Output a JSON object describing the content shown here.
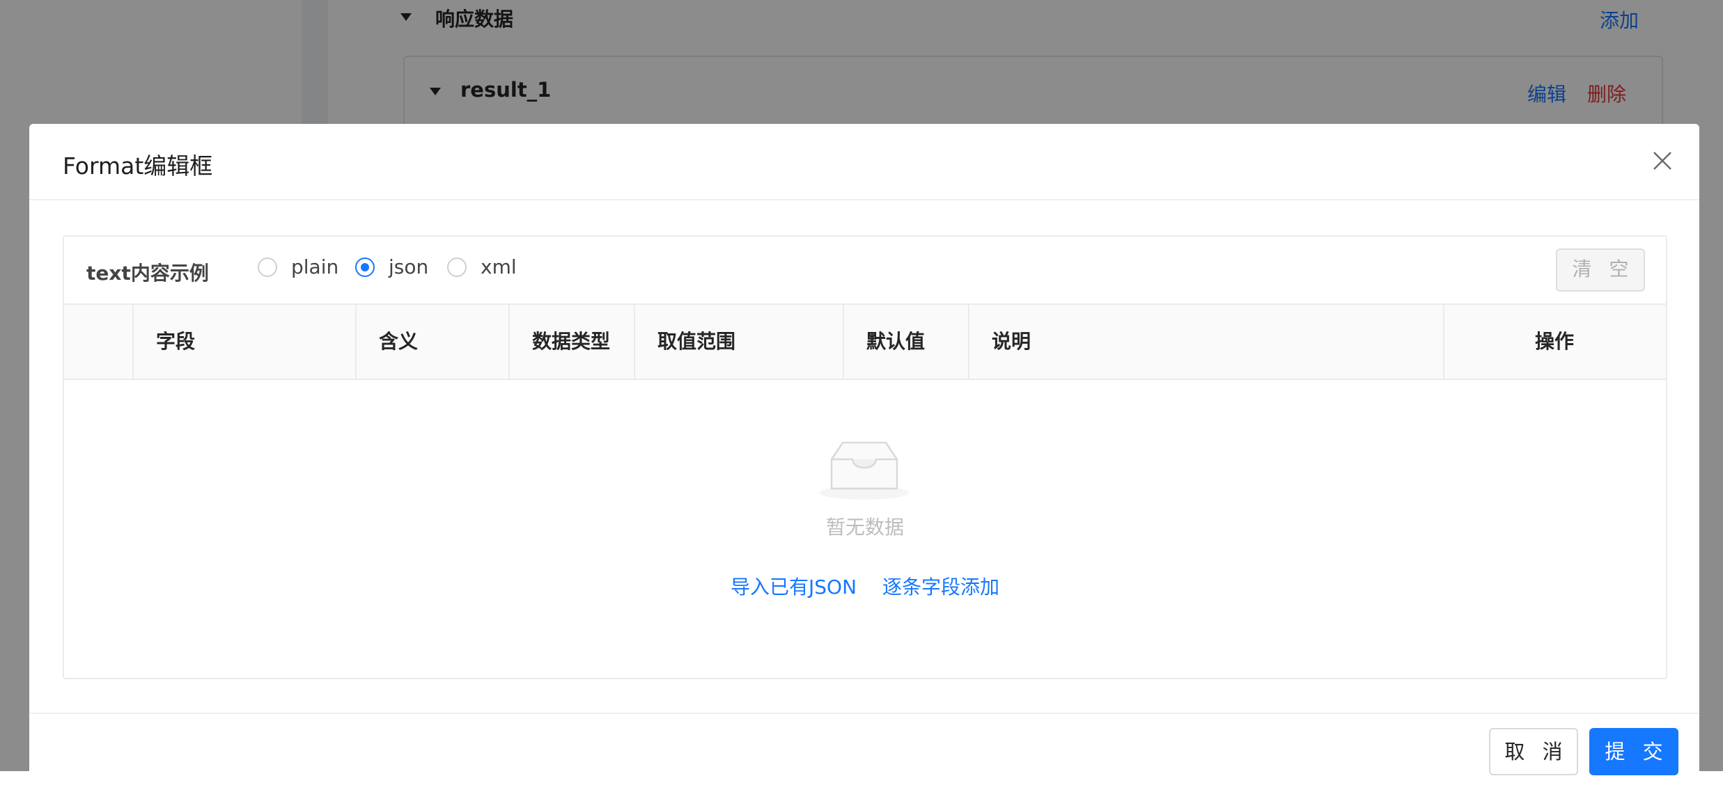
{
  "background": {
    "response_section": {
      "title": "响应数据",
      "add_label": "添加"
    },
    "result_card": {
      "title": "result_1",
      "edit_label": "编辑",
      "delete_label": "删除"
    }
  },
  "modal": {
    "title": "Format编辑框",
    "close_icon": "close-icon",
    "toolbar": {
      "label": "text内容示例",
      "format_options": [
        "plain",
        "json",
        "xml"
      ],
      "selected_format": "json",
      "clear_label": "清 空"
    },
    "table": {
      "columns": [
        "",
        "字段",
        "含义",
        "数据类型",
        "取值范围",
        "默认值",
        "说明",
        "操作"
      ],
      "rows": [],
      "empty_text": "暂无数据",
      "empty_icon": "empty-inbox-icon",
      "import_json_label": "导入已有JSON",
      "add_field_label": "逐条字段添加"
    },
    "footer": {
      "cancel_label": "取 消",
      "submit_label": "提 交"
    }
  },
  "colors": {
    "primary": "#1677ff",
    "danger": "#e53935",
    "mask": "rgba(0,0,0,0.45)"
  }
}
